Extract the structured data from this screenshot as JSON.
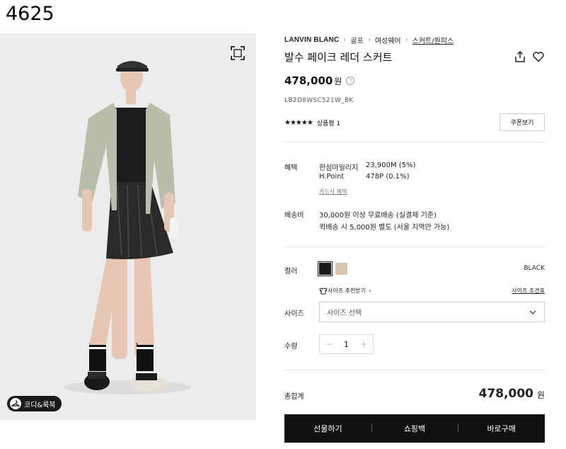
{
  "page_id": "4625",
  "image": {
    "zoom_icon": "fullscreen-icon",
    "coordi_badge": "코디&룩북"
  },
  "breadcrumb": {
    "brand": "LANVIN BLANC",
    "items": [
      "골프",
      "여성웨어",
      "스커트/원피스"
    ]
  },
  "product": {
    "title": "발수 페이크 레더 스커트",
    "price": "478,000",
    "price_unit": "원",
    "sku": "LB2D8WSC521W_BK",
    "stars": "★★★★★",
    "rating": 5,
    "review_label": "상품평 1",
    "coupon_label": "쿠폰보기"
  },
  "benefits": {
    "label": "혜택",
    "rows": [
      {
        "name": "한섬마일리지",
        "value": "23,900M (5%)"
      },
      {
        "name": "H.Point",
        "value": "478P (0.1%)"
      }
    ],
    "card_link": "카드사 혜택"
  },
  "shipping": {
    "label": "배송비",
    "line1": "30,000원 이상 무료배송 (실결제 기준)",
    "line2": "퀵배송 시 5,000원 별도 (서울 지역만 가능)"
  },
  "color": {
    "label": "컬러",
    "selected": "BLACK",
    "swatches": [
      "#1b1b1b",
      "#d9c6ae"
    ]
  },
  "size": {
    "recommend_link": "사이즈 추천받기",
    "chart_link": "사이즈 조견표",
    "label": "사이즈",
    "placeholder": "사이즈 선택"
  },
  "quantity": {
    "label": "수량",
    "value": "1",
    "minus": "−",
    "plus": "+"
  },
  "total": {
    "label": "총합계",
    "price": "478,000",
    "unit": "원"
  },
  "actions": {
    "gift": "선물하기",
    "cart": "쇼핑백",
    "buy": "바로구매"
  }
}
